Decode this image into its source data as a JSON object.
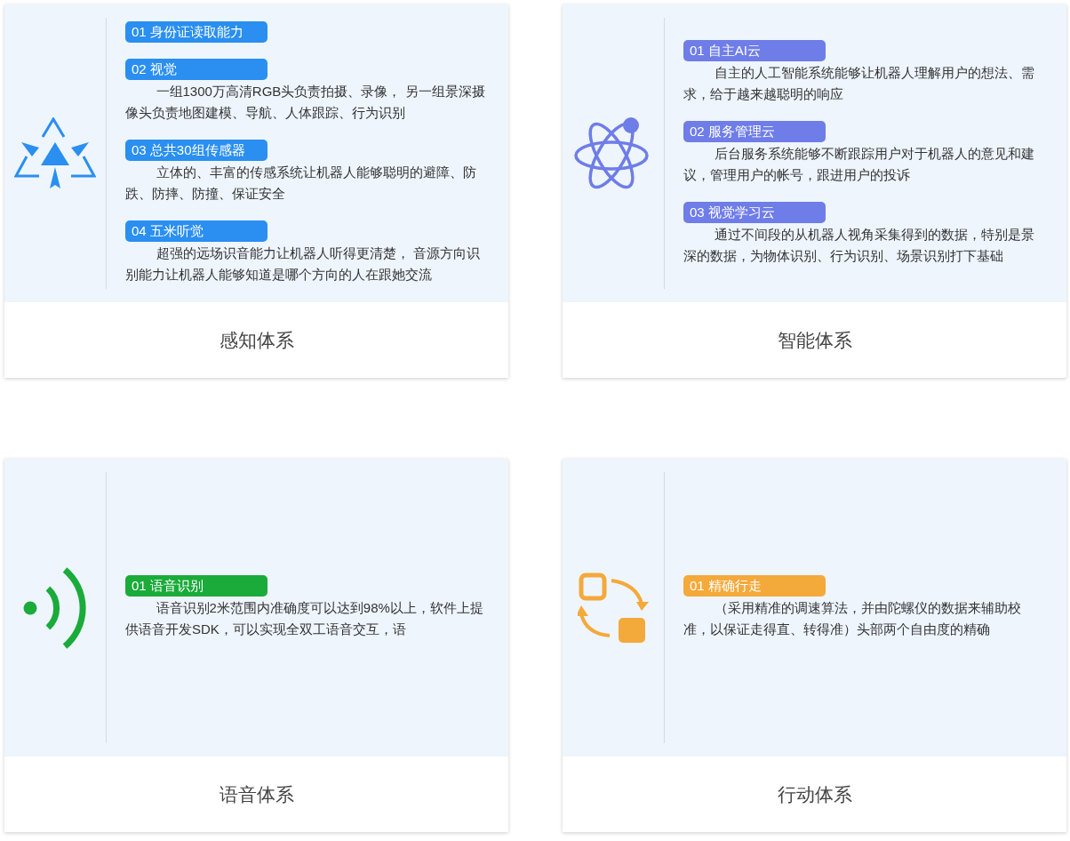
{
  "cards": [
    {
      "title": "感知体系",
      "kind": "triangle",
      "color": "#2a8ff0",
      "items": [
        {
          "label": "01 身份证读取能力"
        },
        {
          "label": "02 视觉",
          "text": "一组1300万高清RGB头负责拍摄、录像， 另一组景深摄像头负责地图建模、导航、人体跟踪、行为识别"
        },
        {
          "label": "03 总共30组传感器",
          "text": "立体的、丰富的传感系统让机器人能够聪明的避障、防跌、防摔、防撞、保证安全"
        },
        {
          "label": "04 五米听觉",
          "text": "超强的远场识音能力让机器人听得更清楚， 音源方向识别能力让机器人能够知道是哪个方向的人在跟她交流"
        }
      ]
    },
    {
      "title": "智能体系",
      "kind": "atom",
      "color": "#6f7de8",
      "items": [
        {
          "label": "01 自主AI云",
          "text": "自主的人工智能系统能够让机器人理解用户的想法、需求，给于越来越聪明的响应"
        },
        {
          "label": "02 服务管理云",
          "text": "后台服务系统能够不断跟踪用户对于机器人的意见和建议，管理用户的帐号，跟进用户的投诉"
        },
        {
          "label": "03 视觉学习云",
          "text": "通过不间段的从机器人视角采集得到的数据，特别是景深的数据，为物体识别、行为识别、场景识别打下基础"
        }
      ]
    },
    {
      "title": "语音体系",
      "kind": "signal",
      "color": "#1aab3a",
      "items": [
        {
          "label": "01 语音识别",
          "text": "语音识别2米范围内准确度可以达到98%以上，软件上提供语音开发SDK，可以实现全双工语音交互，语"
        }
      ]
    },
    {
      "title": "行动体系",
      "kind": "swap",
      "color": "#f4a93b",
      "items": [
        {
          "label": "01 精确行走",
          "text": "（采用精准的调速算法，并由陀螺仪的数据来辅助校准，以保证走得直、转得准）头部两个自由度的精确"
        }
      ]
    }
  ]
}
